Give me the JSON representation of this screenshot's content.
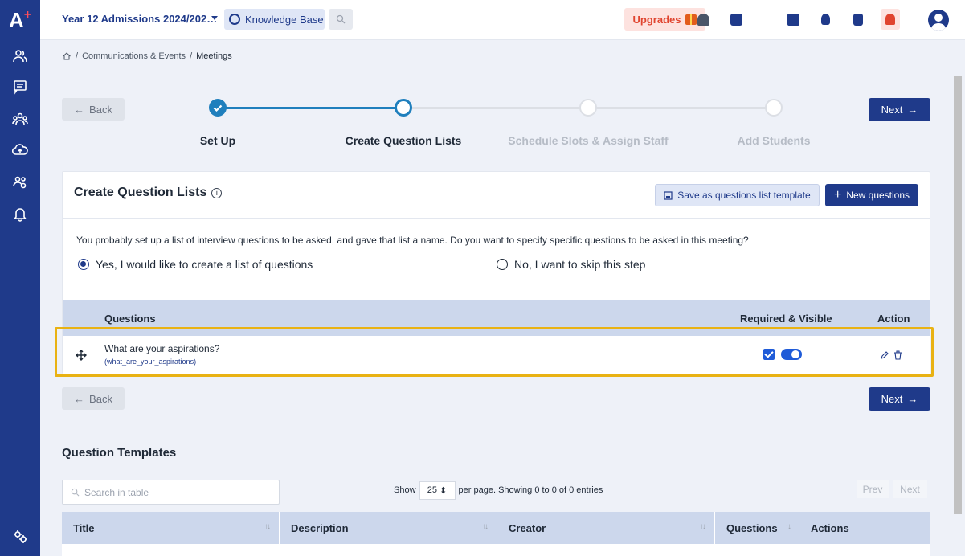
{
  "app": {
    "logo": "A",
    "logo_plus": "+",
    "context_title": "Year 12 Admissions 2024/202…",
    "knowledge_base": "Knowledge Base",
    "upgrades": "Upgrades",
    "accent_color": "#1f3a8a"
  },
  "breadcrumb": {
    "items": [
      "Communications & Events",
      "Meetings"
    ],
    "separator": "/"
  },
  "nav": {
    "back": "Back",
    "next": "Next"
  },
  "stepper": {
    "steps": [
      {
        "label": "Set Up",
        "state": "complete"
      },
      {
        "label": "Create Question Lists",
        "state": "current"
      },
      {
        "label": "Schedule Slots & Assign Staff",
        "state": "pending"
      },
      {
        "label": "Add Students",
        "state": "pending"
      }
    ]
  },
  "card": {
    "title": "Create Question Lists",
    "save_template": "Save as questions list template",
    "new_questions": "New questions",
    "prompt": "You probably set up a list of interview questions to be asked, and gave that list a name. Do you want to specify specific questions to be asked in this meeting?",
    "option_yes": "Yes, I would like to create a list of questions",
    "option_no": "No, I want to skip this step",
    "selected_option": "yes",
    "table": {
      "headers": {
        "questions": "Questions",
        "required": "Required & Visible",
        "action": "Action"
      },
      "rows": [
        {
          "question": "What are your aspirations?",
          "key": "(what_are_your_aspirations)",
          "required": true,
          "visible": true
        }
      ]
    }
  },
  "templates": {
    "title": "Question Templates",
    "search_placeholder": "Search in table",
    "show_label": "Show",
    "page_size": "25",
    "per_page_text": "per page. Showing 0 to 0 of 0 entries",
    "prev": "Prev",
    "next": "Next",
    "columns": [
      "Title",
      "Description",
      "Creator",
      "Questions",
      "Actions"
    ]
  }
}
